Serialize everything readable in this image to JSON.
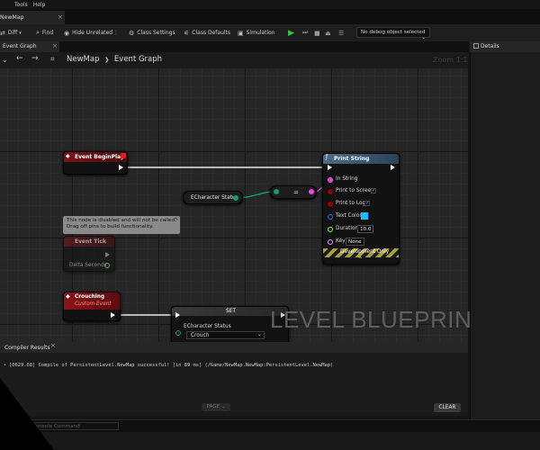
{
  "menu": {
    "items": [
      "",
      "Tools",
      "Help"
    ]
  },
  "document_tab": {
    "label": "NewMap"
  },
  "toolbar": {
    "diff_label": "Diff",
    "find_label": "Find",
    "hide_unrelated_label": "Hide Unrelated",
    "class_settings_label": "Class Settings",
    "class_defaults_label": "Class Defaults",
    "simulation_label": "Simulation",
    "debug_select_value": "No debug object selected"
  },
  "graph": {
    "tab_label": "Event Graph",
    "breadcrumb_root": "NewMap",
    "breadcrumb_sep": "❯",
    "breadcrumb_leaf": "Event Graph",
    "zoom_label": "Zoom 1:1",
    "watermark": "LEVEL BLUEPRINT"
  },
  "nodes": {
    "begin_play": {
      "title": "Event BeginPlay"
    },
    "print_string": {
      "title": "Print String",
      "in_string": "In String",
      "print_to_screen": "Print to Screen",
      "print_to_log": "Print to Log",
      "text_color": "Text Color",
      "duration": "Duration",
      "duration_value": "10.0",
      "key": "Key",
      "key_value": "None",
      "dev_only": "Development Only"
    },
    "echar_status": {
      "title": "ECharacter Status"
    },
    "equal": {
      "symbol": "="
    },
    "event_tick": {
      "tooltip": "This node is disabled and will not be called. Drag off pins to build functionality.",
      "title": "Event Tick",
      "delta": "Delta Seconds"
    },
    "crouching": {
      "title": "Crouching",
      "subtitle": "Custom Event"
    },
    "set": {
      "title": "SET",
      "var_label": "ECharacter Status",
      "value": "Crouch"
    }
  },
  "details": {
    "tab_label": "Details"
  },
  "compiler": {
    "tab_label": "Compiler Results",
    "message": "[0629.68] Compile of PersistentLevel.NewMap successful! [in 89 ms] (/Game/NewMap.NewMap:PersistentLevel.NewMap)",
    "page_label": "PAGE",
    "clear_label": "CLEAR"
  },
  "status": {
    "console_placeholder": "Console Command"
  },
  "colors": {
    "exec": "#ffffff",
    "string_pin": "#e64ad8",
    "enum_pin": "#0f9d7a",
    "bool_pin": "#8f0000",
    "struct_pin": "#1f6fd8",
    "float_pin": "#8ee67e",
    "name_pin": "#c7a4ff",
    "text_color_swatch": "#1fb9ff"
  }
}
